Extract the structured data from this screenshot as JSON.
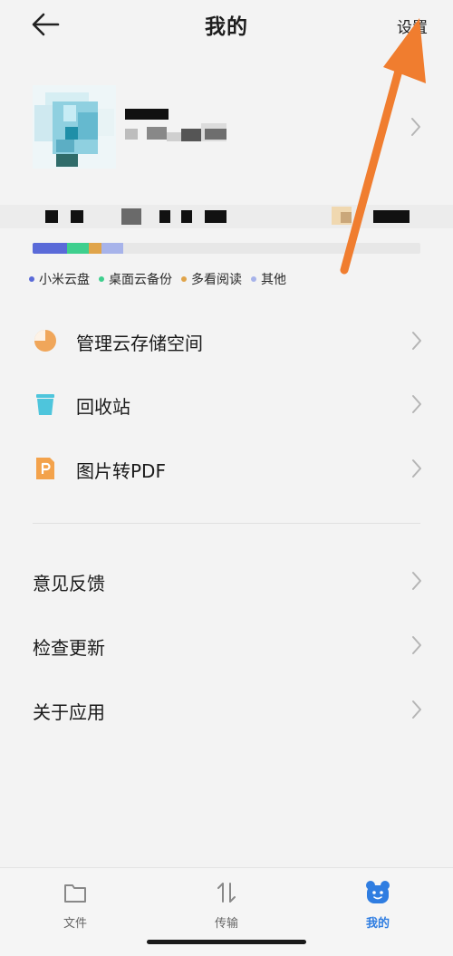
{
  "header": {
    "title": "我的",
    "settings_label": "设置"
  },
  "storage_legend": [
    {
      "label": "小米云盘",
      "color": "#5a6ad8"
    },
    {
      "label": "桌面云备份",
      "color": "#3ecf8e"
    },
    {
      "label": "多看阅读",
      "color": "#e0a44a"
    },
    {
      "label": "其他",
      "color": "#a7b3ea"
    }
  ],
  "menu": {
    "manage_storage": "管理云存储空间",
    "recycle_bin": "回收站",
    "image_to_pdf": "图片转PDF",
    "feedback": "意见反馈",
    "check_update": "检查更新",
    "about": "关于应用"
  },
  "bottom_nav": {
    "files": "文件",
    "transfer": "传输",
    "mine": "我的",
    "active": "mine"
  },
  "colors": {
    "accent": "#2f7de1",
    "storage_icon": "#f0a65a",
    "recycle_icon": "#4ec5dc",
    "pdf_icon": "#f3a24b",
    "annotation_arrow": "#f07d2f"
  }
}
